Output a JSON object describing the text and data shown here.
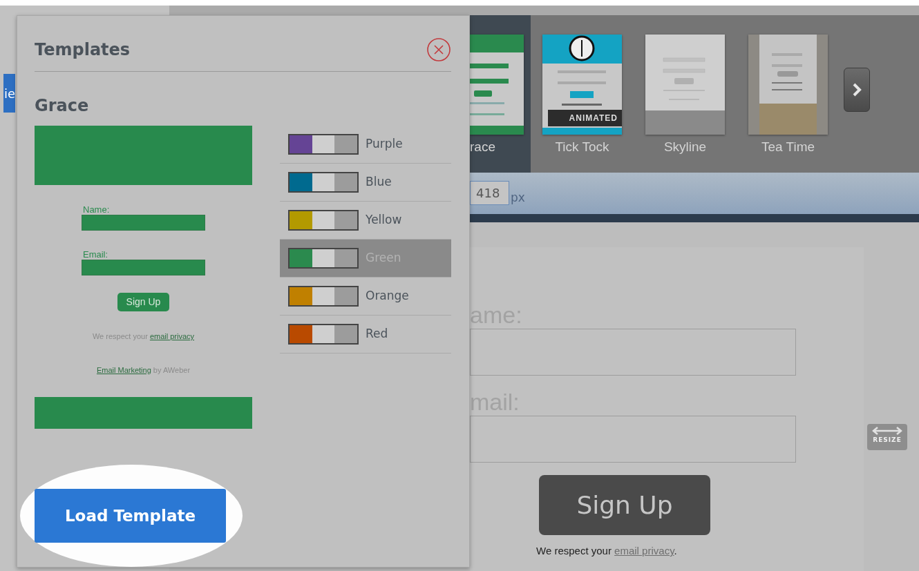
{
  "sidebar_tab": {
    "label": "ie"
  },
  "gallery": {
    "items": [
      {
        "kind": "grace",
        "label": "race",
        "selected": true
      },
      {
        "kind": "ticktock",
        "label": "Tick Tock",
        "badge": "ANIMATED",
        "selected": false
      },
      {
        "kind": "skyline",
        "label": "Skyline",
        "selected": false
      },
      {
        "kind": "teatime",
        "label": "Tea Time",
        "selected": false
      }
    ]
  },
  "width_field": {
    "value": "418",
    "unit": "px"
  },
  "form_preview": {
    "name_label": "ame:",
    "email_label": "mail:",
    "button": "Sign Up",
    "privacy_text": "We respect your",
    "privacy_link": "email privacy",
    "privacy_end": "."
  },
  "resize_handle": {
    "label": "RESIZE"
  },
  "modal": {
    "title": "Templates",
    "template_name": "Grace",
    "preview": {
      "name_label": "Name:",
      "email_label": "Email:",
      "button": "Sign Up",
      "privacy_text": "We respect your",
      "privacy_link": "email privacy",
      "marketing_link": "Email Marketing",
      "marketing_text": "by AWeber"
    },
    "color_options": [
      {
        "label": "Purple",
        "color": "#654495",
        "selected": false
      },
      {
        "label": "Blue",
        "color": "#006a8f",
        "selected": false
      },
      {
        "label": "Yellow",
        "color": "#b39a00",
        "selected": false
      },
      {
        "label": "Green",
        "color": "#2b8a4e",
        "selected": true
      },
      {
        "label": "Orange",
        "color": "#c08000",
        "selected": false
      },
      {
        "label": "Red",
        "color": "#b94a00",
        "selected": false
      }
    ],
    "load_button": "Load Template"
  }
}
